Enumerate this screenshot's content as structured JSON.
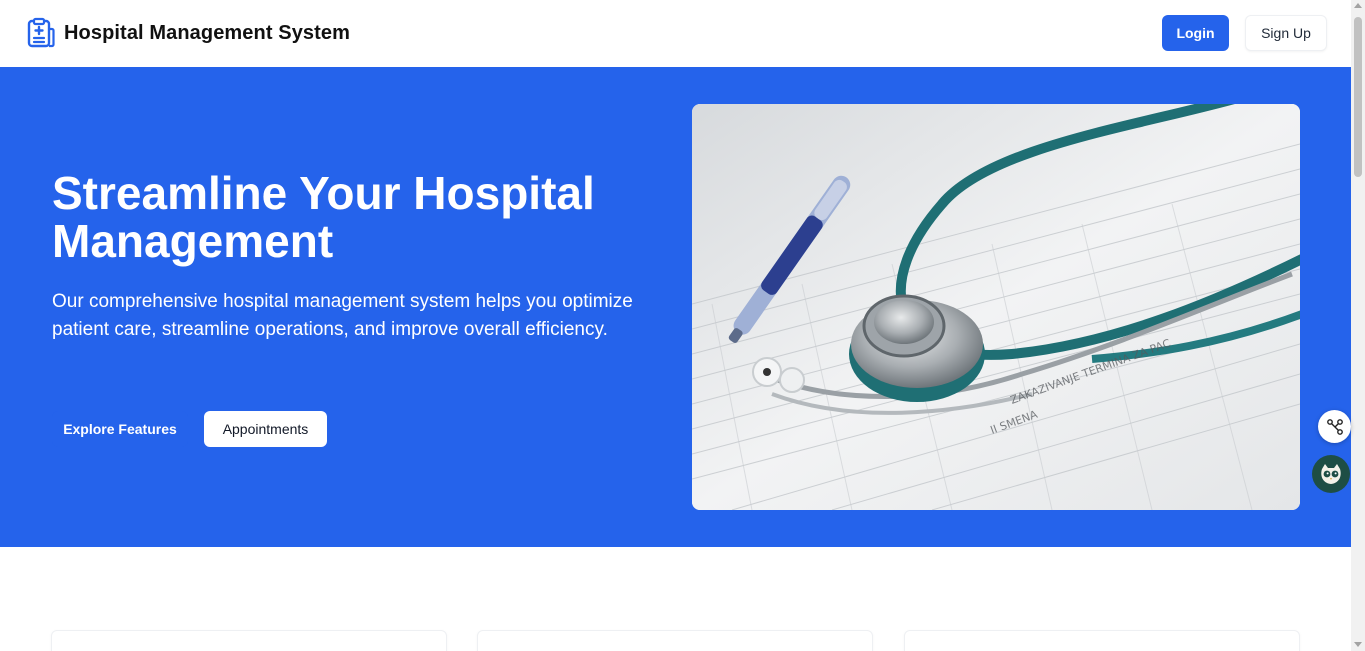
{
  "header": {
    "brand_title": "Hospital Management System",
    "brand_icon": "hospital-clipboard-icon",
    "login_label": "Login",
    "signup_label": "Sign Up"
  },
  "hero": {
    "title": "Streamline Your Hospital Management",
    "description": "Our comprehensive hospital management system helps you optimize patient care, streamline operations, and improve overall efficiency.",
    "explore_label": "Explore Features",
    "appointments_label": "Appointments",
    "image": "stethoscope-pen-medical-form-photo"
  },
  "widgets": {
    "share_icon": "share-nodes-icon",
    "assistant_icon": "owl-assistant-icon"
  },
  "colors": {
    "primary": "#2563eb",
    "white": "#ffffff",
    "text_dark": "#111111",
    "owl_bg": "#1e4e45"
  }
}
